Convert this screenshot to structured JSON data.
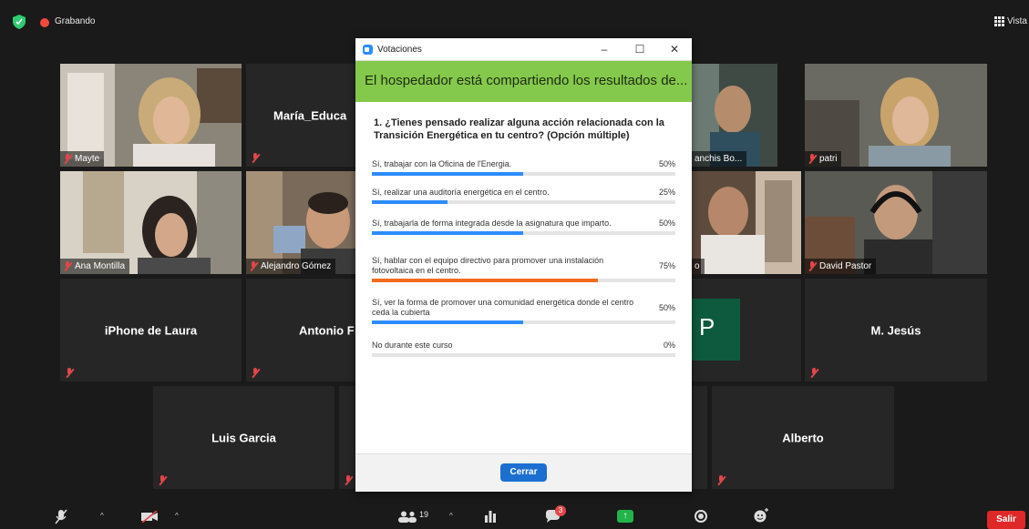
{
  "topbar": {
    "recording_label": "Grabando",
    "view_label": "Vista"
  },
  "participants": {
    "mayte": "Mayte",
    "maria": "María_Educa",
    "sanchis": "anchis Bo...",
    "patri": "patri",
    "ana": "Ana Montilla",
    "alejandro": "Alejandro Gómez",
    "o_partial": "o",
    "david": "David Pastor",
    "iphone_laura": "iPhone de Laura",
    "antonio": "Antonio F",
    "p_initial": "P",
    "m_jesus": "M. Jesús",
    "luis": "Luis Garcia",
    "alberto": "Alberto"
  },
  "poll": {
    "window_title": "Votaciones",
    "banner": "El hospedador está compartiendo los resultados de...",
    "question": "1. ¿Tienes pensado realizar alguna acción relacionada con la Transición Energética en tu centro? (Opción múltiple)",
    "options": [
      {
        "text": "Sí, trabajar con la Oficina de l'Energia.",
        "percent": "50%",
        "value": 50,
        "color": "#2d8cff"
      },
      {
        "text": "Sí, realizar una auditoría energética en el centro.",
        "percent": "25%",
        "value": 25,
        "color": "#2d8cff"
      },
      {
        "text": "Sí, trabajarla de forma integrada desde la asignatura que imparto.",
        "percent": "50%",
        "value": 50,
        "color": "#2d8cff"
      },
      {
        "text": "Sí, hablar con el equipo directivo para promover una instalación fotovoltaica en el centro.",
        "percent": "75%",
        "value": 75,
        "color": "#f26b1d"
      },
      {
        "text": "Sí, ver la forma de promover una comunidad energética donde el centro ceda la cubierta",
        "percent": "50%",
        "value": 50,
        "color": "#2d8cff"
      },
      {
        "text": "No durante este curso",
        "percent": "0%",
        "value": 0,
        "color": "#2d8cff"
      }
    ],
    "close_label": "Cerrar"
  },
  "toolbar": {
    "participants_count": "19",
    "chat_badge": "3",
    "exit_label": "Salir"
  },
  "colors": {
    "accent": "#2d8cff",
    "banner": "#84c94c",
    "highlight": "#f26b1d",
    "exit": "#e02828",
    "avatar_p": "#0e5a3e"
  }
}
